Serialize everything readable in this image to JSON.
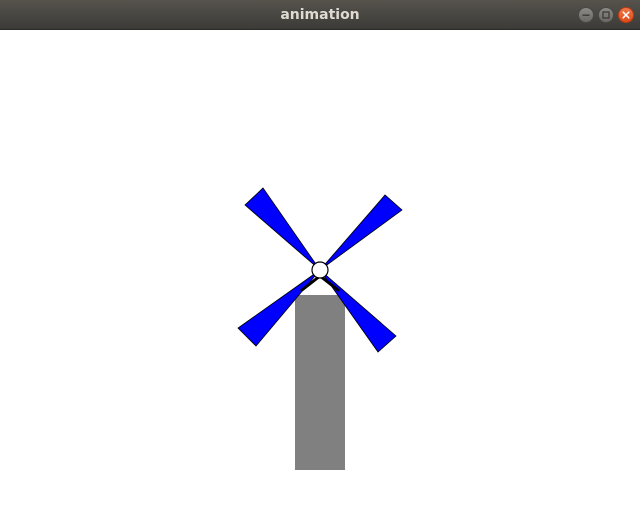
{
  "window": {
    "title": "animation",
    "buttons": {
      "minimize_icon": "minimize-icon",
      "maximize_icon": "maximize-icon",
      "close_icon": "close-icon"
    }
  },
  "scene": {
    "tower_color": "#808080",
    "blade_color": "#0000ff",
    "hub_fill": "#ffffff",
    "hub_stroke": "#000000",
    "background": "#ffffff"
  }
}
